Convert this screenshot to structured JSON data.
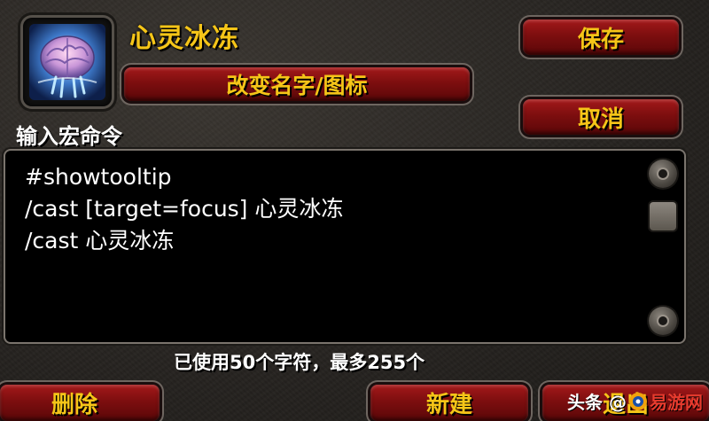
{
  "macro": {
    "name": "心灵冰冻",
    "icon": "brain-frost-icon",
    "change_name_icon_label": "改变名字/图标",
    "input_label": "输入宏命令",
    "lines": [
      "#showtooltip",
      "/cast [target=focus] 心灵冰冻",
      "/cast 心灵冰冻"
    ],
    "char_count_text": "已使用50个字符，最多255个"
  },
  "buttons": {
    "save": "保存",
    "cancel": "取消",
    "delete": "删除",
    "new": "新建",
    "exit": "退出"
  },
  "watermark": {
    "prefix": "头条 @",
    "site": "易游网"
  },
  "colors": {
    "gold_text": "#f5c518",
    "button_red": "#8b1213"
  }
}
